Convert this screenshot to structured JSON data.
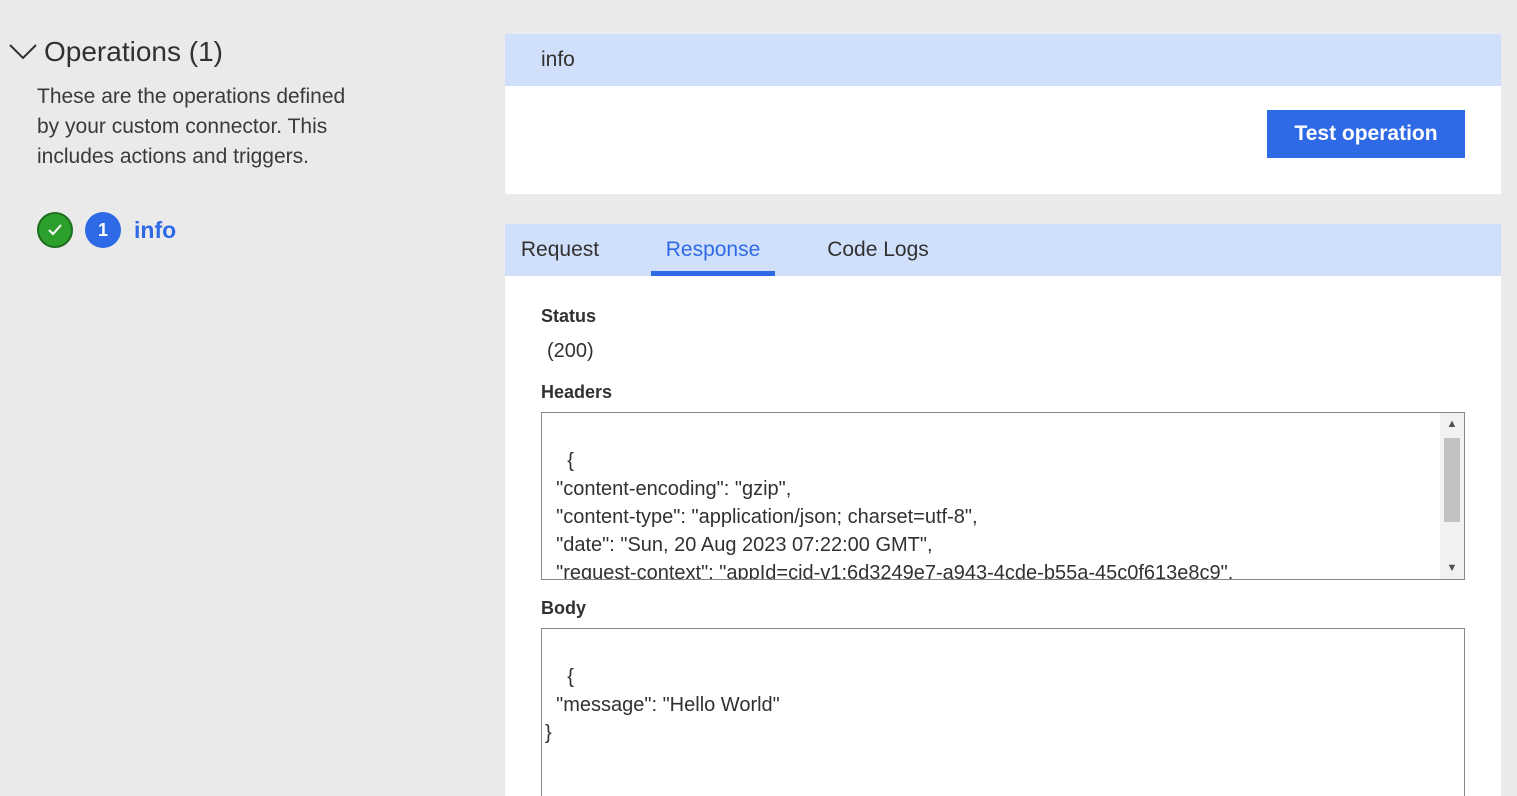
{
  "operations": {
    "title": "Operations (1)",
    "description": "These are the operations defined by your custom connector. This includes actions and triggers.",
    "items": [
      {
        "number": "1",
        "label": "info",
        "status": "success"
      }
    ]
  },
  "operation_card": {
    "title": "info",
    "test_button_label": "Test operation"
  },
  "tabs": [
    {
      "label": "Request",
      "active": false
    },
    {
      "label": "Response",
      "active": true
    },
    {
      "label": "Code Logs",
      "active": false
    }
  ],
  "response": {
    "status_label": "Status",
    "status_value": "(200)",
    "headers_label": "Headers",
    "headers_text": "{\n  \"content-encoding\": \"gzip\",\n  \"content-type\": \"application/json; charset=utf-8\",\n  \"date\": \"Sun, 20 Aug 2023 07:22:00 GMT\",\n  \"request-context\": \"appId=cid-v1:6d3249e7-a943-4cde-b55a-45c0f613e8c9\",\n  \"vary\": \"Accept-Encoding\",",
    "body_label": "Body",
    "body_text": "{\n  \"message\": \"Hello World\"\n}"
  },
  "icons": {
    "collapse": "chevron-down-icon",
    "success": "checkmark-icon",
    "scroll_up": "scroll-up-arrow-icon",
    "scroll_down": "scroll-down-arrow-icon"
  },
  "colors": {
    "accent": "#2f6ae6",
    "success": "#2d9f2d",
    "header_bar": "#d0e0fb",
    "page_bg": "#eaeaea"
  }
}
